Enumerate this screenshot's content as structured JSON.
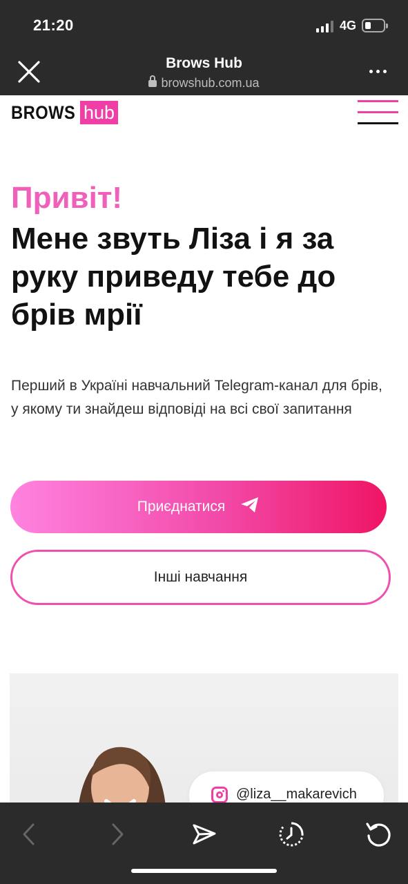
{
  "status_bar": {
    "time": "21:20",
    "network": "4G"
  },
  "browser": {
    "title": "Brows Hub",
    "url": "browshub.com.ua"
  },
  "site": {
    "logo": {
      "brows": "BROWS",
      "hub": "hub"
    }
  },
  "hero": {
    "greeting": "Привіт!",
    "headline": "Мене звуть Ліза і я за руку приведу тебе до брів мрії",
    "description": "Перший в Україні навчальний Telegram-канал для брів, у якому ти знайдеш відповіді на всі свої запитання",
    "join_button": "Приєднатися",
    "other_button": "Інші навчання"
  },
  "profile": {
    "instagram": "@liza__makarevich"
  },
  "colors": {
    "accent": "#ef3fa6",
    "chrome": "#2b2b2b"
  },
  "icons": {
    "close": "close-icon",
    "more": "more-icon",
    "menu": "hamburger-icon",
    "join": "telegram-icon",
    "instagram": "instagram-icon",
    "back": "chevron-left-icon",
    "forward": "chevron-right-icon",
    "share": "send-icon",
    "history": "history-icon",
    "reload": "reload-icon"
  }
}
